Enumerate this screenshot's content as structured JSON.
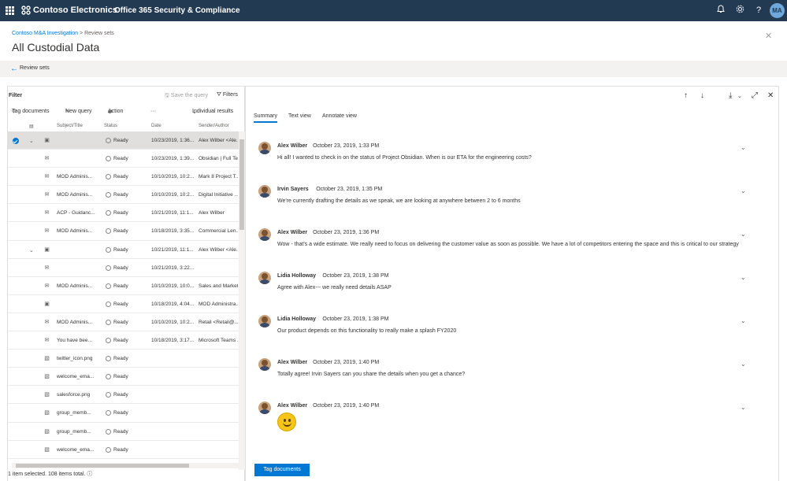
{
  "topbar": {
    "brand": "Contoso Electronics",
    "app_title": "Office 365 Security & Compliance",
    "avatar_initials": "MA",
    "icons": [
      "bell-icon",
      "gear-icon",
      "help-icon"
    ]
  },
  "breadcrumb": {
    "parent": "Contoso M&A Investigation",
    "separator": ">",
    "current": "Review sets"
  },
  "page_title": "All Custodial Data",
  "back_label": "Review sets",
  "left_pane": {
    "filter_label": "Filter",
    "save_query": "Save the query",
    "filters": "Filters",
    "toolbar": {
      "tag_documents": "Tag documents",
      "new_query": "New query",
      "action": "Action",
      "more": "···",
      "view": "Individual results"
    },
    "columns": [
      "Subject/Title",
      "Status",
      "Date",
      "Sender/Author"
    ],
    "rows": [
      {
        "title": "",
        "status": "Ready",
        "date": "10/23/2019, 1:36...",
        "sender": "Alex Wilber <Ale...",
        "icon": "teams-icon",
        "selected": true,
        "expand": true
      },
      {
        "title": "",
        "status": "Ready",
        "date": "10/23/2019, 1:39...",
        "sender": "Obsidian | Full Te...",
        "icon": "mail-icon"
      },
      {
        "title": "MOD Adminis...",
        "status": "Ready",
        "date": "10/10/2019, 10:2...",
        "sender": "Mark 8 Project T...",
        "icon": "mail-icon"
      },
      {
        "title": "MOD Adminis...",
        "status": "Ready",
        "date": "10/10/2019, 10:2...",
        "sender": "Digital Initiative ...",
        "icon": "mail-icon"
      },
      {
        "title": "ACP - Guidanc...",
        "status": "Ready",
        "date": "10/21/2019, 11:1...",
        "sender": "Alex Wilber",
        "icon": "mail-icon"
      },
      {
        "title": "MOD Adminis...",
        "status": "Ready",
        "date": "10/18/2019, 3:35...",
        "sender": "Commercial Len...",
        "icon": "mail-icon"
      },
      {
        "title": "",
        "status": "Ready",
        "date": "10/21/2019, 11:1...",
        "sender": "Alex Wilber <Ale...",
        "icon": "teams-icon",
        "expand": true
      },
      {
        "title": "",
        "status": "Ready",
        "date": "10/21/2019, 3:22...",
        "sender": "",
        "icon": "mail-icon"
      },
      {
        "title": "MOD Adminis...",
        "status": "Ready",
        "date": "10/10/2019, 10:0...",
        "sender": "Sales and Market...",
        "icon": "mail-icon"
      },
      {
        "title": "",
        "status": "Ready",
        "date": "10/18/2019, 4:04...",
        "sender": "MOD Administra...",
        "icon": "teams-icon"
      },
      {
        "title": "MOD Adminis...",
        "status": "Ready",
        "date": "10/10/2019, 10:2...",
        "sender": "Retail <Retail@...",
        "icon": "mail-icon"
      },
      {
        "title": "You have bee...",
        "status": "Ready",
        "date": "10/18/2019, 3:17...",
        "sender": "Microsoft Teams ...",
        "icon": "mail-icon"
      },
      {
        "title": "twitter_icon.png",
        "status": "Ready",
        "date": "",
        "sender": "",
        "icon": "image-file-icon"
      },
      {
        "title": "welcome_ema...",
        "status": "Ready",
        "date": "",
        "sender": "",
        "icon": "image-file-icon"
      },
      {
        "title": "salesforce.png",
        "status": "Ready",
        "date": "",
        "sender": "",
        "icon": "image-file-icon"
      },
      {
        "title": "group_memb...",
        "status": "Ready",
        "date": "",
        "sender": "",
        "icon": "image-file-icon"
      },
      {
        "title": "group_memb...",
        "status": "Ready",
        "date": "",
        "sender": "",
        "icon": "image-file-icon"
      },
      {
        "title": "welcome_ema...",
        "status": "Ready",
        "date": "",
        "sender": "",
        "icon": "image-file-icon"
      }
    ],
    "status_line": "1 item selected.   108 items total."
  },
  "right_pane": {
    "tabs": [
      "Summary",
      "Text view",
      "Annotate view"
    ],
    "active_tab": "Summary",
    "messages": [
      {
        "author": "Alex Wilber",
        "time": "October 23, 2019, 1:33 PM",
        "text": "Hi all! I wanted to check in on the status of Project Obsidian. When is our ETA for the engineering costs?"
      },
      {
        "author": "Irvin Sayers",
        "time": "October 23, 2019, 1:35 PM",
        "text": "We're currently drafting the details as we speak, we are looking at anywhere between 2 to 6 months"
      },
      {
        "author": "Alex Wilber",
        "time": "October 23, 2019, 1:36 PM",
        "text": "Wow - that's a wide estimate. We really need to focus on delivering the customer value as soon as possible. We have a lot of competitors entering the space and this is critical to our strategy"
      },
      {
        "author": "Lidia Holloway",
        "time": "October 23, 2019, 1:38 PM",
        "text": "Agree with Alex--- we really need details ASAP"
      },
      {
        "author": "Lidia Holloway",
        "time": "October 23, 2019, 1:38 PM",
        "text": "Our product depends on this functionality to really make a splash FY2020"
      },
      {
        "author": "Alex Wilber",
        "time": "October 23, 2019, 1:40 PM",
        "text": "Totally agree! Irvin Sayers can you share the details when you get a chance?"
      },
      {
        "author": "Alex Wilber",
        "time": "October 23, 2019, 1:40 PM",
        "text": ""
      }
    ],
    "tag_button": "Tag documents"
  }
}
